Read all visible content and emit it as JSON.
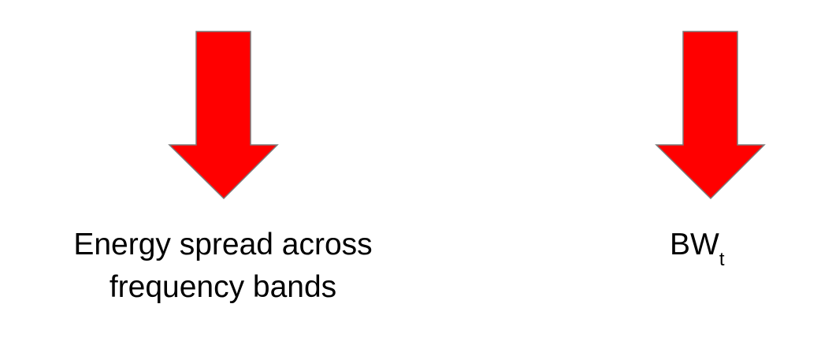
{
  "colors": {
    "arrow_fill": "#ff0000",
    "arrow_stroke": "#7a7a7a",
    "text": "#000000",
    "background": "#ffffff"
  },
  "left": {
    "icon": "arrow-down-icon",
    "caption_line1": "Energy spread across",
    "caption_line2": "frequency bands"
  },
  "right": {
    "icon": "arrow-down-icon",
    "label_main": "BW",
    "label_sub": "t"
  }
}
